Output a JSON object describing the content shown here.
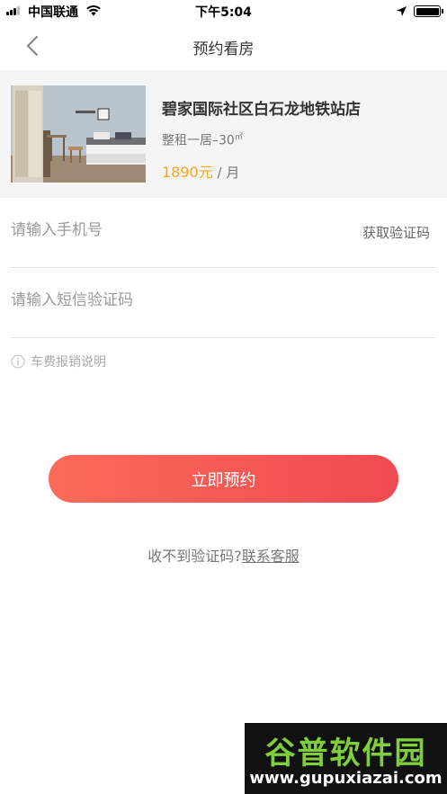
{
  "status_bar": {
    "carrier": "中国联通",
    "time": "下午5:04"
  },
  "nav": {
    "title": "预约看房"
  },
  "listing": {
    "name": "碧家国际社区白石龙地铁站店",
    "spec": "整租一居–30",
    "spec_unit": "㎡",
    "price": "1890元",
    "price_unit": " / 月"
  },
  "form": {
    "phone_placeholder": "请输入手机号",
    "get_code_label": "获取验证码",
    "sms_placeholder": "请输入短信验证码",
    "note": "车费报销说明",
    "submit_label": "立即预约"
  },
  "help": {
    "question": "收不到验证码?",
    "link": "联系客服"
  },
  "watermark": {
    "name": "谷普软件园",
    "url": "www.gupuxiazai.com"
  },
  "colors": {
    "accent_start": "#fb6b58",
    "accent_end": "#ef4a52",
    "price": "#f5a623"
  }
}
